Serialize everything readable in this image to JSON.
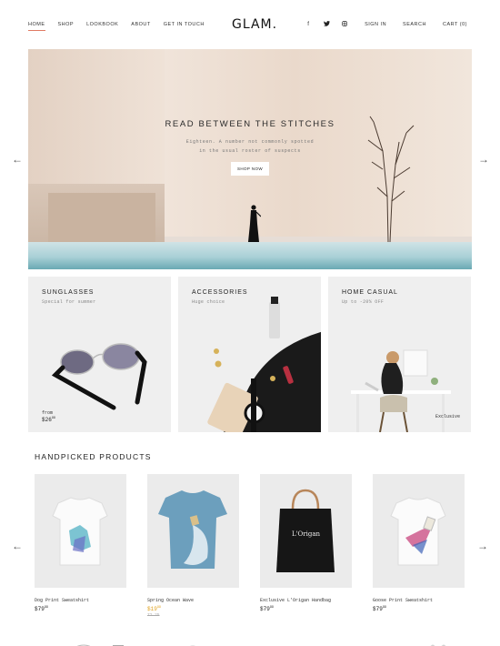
{
  "header": {
    "nav": [
      "HOME",
      "SHOP",
      "LOOKBOOK",
      "ABOUT",
      "GET IN TOUCH"
    ],
    "logo": "GLAM.",
    "social": [
      {
        "icon": "facebook-icon",
        "glyph": "f"
      },
      {
        "icon": "twitter-icon",
        "glyph": "t"
      },
      {
        "icon": "instagram-icon",
        "glyph": "◎"
      }
    ],
    "sign_in": "SIGN IN",
    "search": "SEARCH",
    "cart": "CART (0)"
  },
  "hero": {
    "title": "READ BETWEEN THE STITCHES",
    "subtitle_line1": "Eighteen. A number not commonly spotted",
    "subtitle_line2": "in the usual roster of suspects",
    "button": "SHOP NOW",
    "prev": "←",
    "next": "→"
  },
  "categories": [
    {
      "title": "SUNGLASSES",
      "subtitle": "Special for summer",
      "from_label": "from",
      "price_main": "$26",
      "price_cents": "99"
    },
    {
      "title": "ACCESSORIES",
      "subtitle": "Huge choice"
    },
    {
      "title": "HOME CASUAL",
      "subtitle": "Up to -20% OFF",
      "badge": "Exclusive"
    }
  ],
  "products_section": {
    "title": "HANDPICKED PRODUCTS",
    "prev": "←",
    "next": "→",
    "items": [
      {
        "name": "Dog Print Sweatshirt",
        "price_main": "$79",
        "price_cents": "99"
      },
      {
        "name": "Spring Ocean Wave",
        "price_main": "$19",
        "price_cents": "99",
        "old_price": "72.25"
      },
      {
        "name": "Exclusive L'Origan Handbag",
        "price_main": "$79",
        "price_cents": "99",
        "bag_label": "L'Origan"
      },
      {
        "name": "Goose Print Sweatshirt",
        "price_main": "$79",
        "price_cents": "99"
      }
    ]
  },
  "colors": {
    "accent": "#e07b63",
    "sale": "#e0a21f",
    "card_bg": "#efefef"
  }
}
